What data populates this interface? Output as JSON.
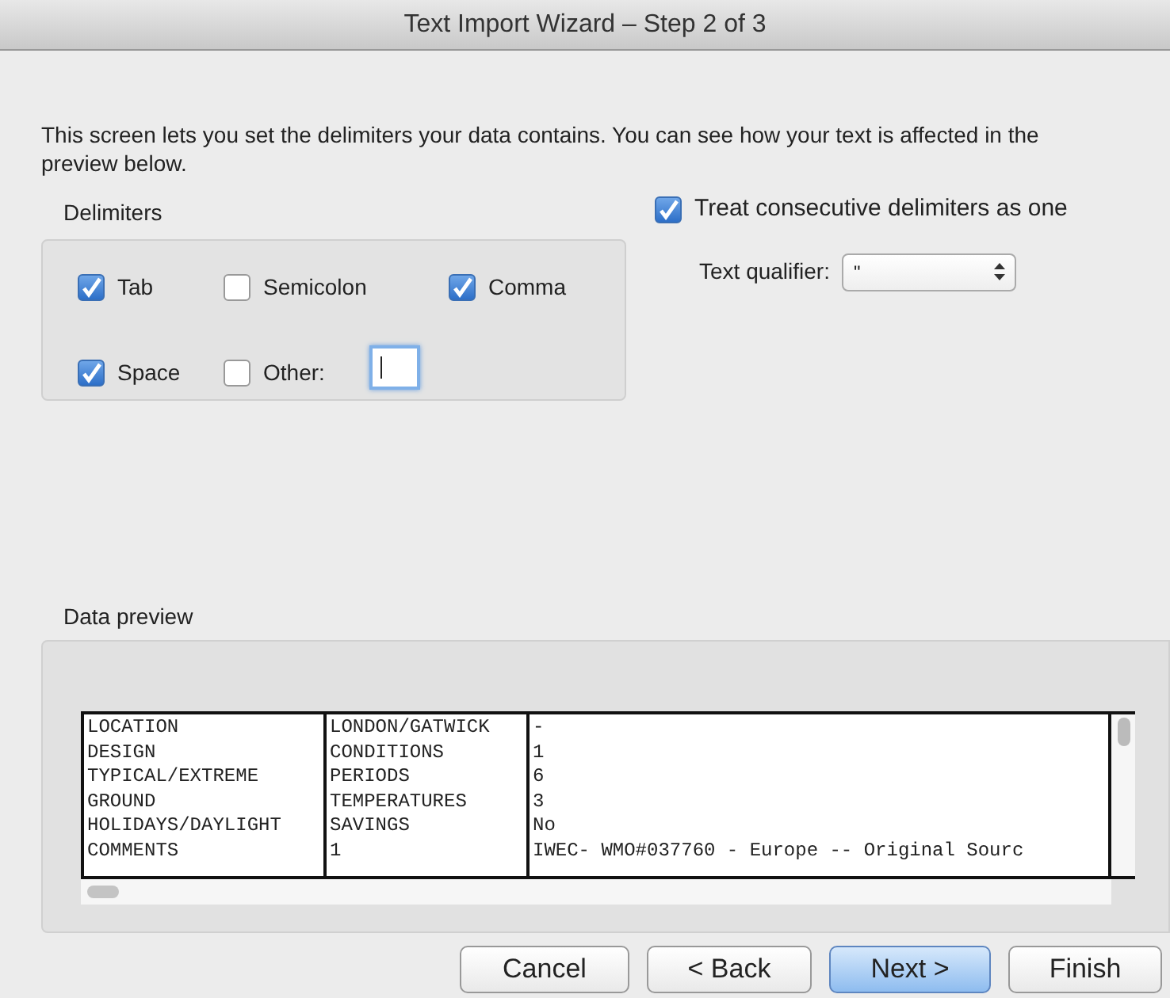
{
  "window": {
    "title": "Text Import Wizard – Step 2 of 3"
  },
  "description": "This screen lets you set the delimiters your data contains.  You can see how your text is affected in the preview below.",
  "delimiters": {
    "label": "Delimiters",
    "options": [
      {
        "label": "Tab",
        "checked": true
      },
      {
        "label": "Semicolon",
        "checked": false
      },
      {
        "label": "Comma",
        "checked": true
      },
      {
        "label": "Space",
        "checked": true
      },
      {
        "label": "Other:",
        "checked": false,
        "kind": "other"
      }
    ]
  },
  "treat_consecutive": {
    "label": "Treat consecutive delimiters as one",
    "checked": true
  },
  "text_qualifier": {
    "label": "Text qualifier:",
    "value": "\""
  },
  "data_preview": {
    "label": "Data preview",
    "rows": [
      [
        "LOCATION",
        "LONDON/GATWICK",
        "-"
      ],
      [
        "DESIGN",
        "CONDITIONS",
        "1"
      ],
      [
        "TYPICAL/EXTREME",
        "PERIODS",
        "6"
      ],
      [
        "GROUND",
        "TEMPERATURES",
        "3"
      ],
      [
        "HOLIDAYS/DAYLIGHT",
        "SAVINGS",
        "No"
      ],
      [
        "COMMENTS",
        "1",
        "IWEC- WMO#037760 - Europe -- Original Sourc"
      ]
    ]
  },
  "buttons": [
    {
      "label": "Cancel",
      "default": false
    },
    {
      "label": "< Back",
      "default": false
    },
    {
      "label": "Next >",
      "default": true
    },
    {
      "label": "Finish",
      "default": false
    }
  ]
}
